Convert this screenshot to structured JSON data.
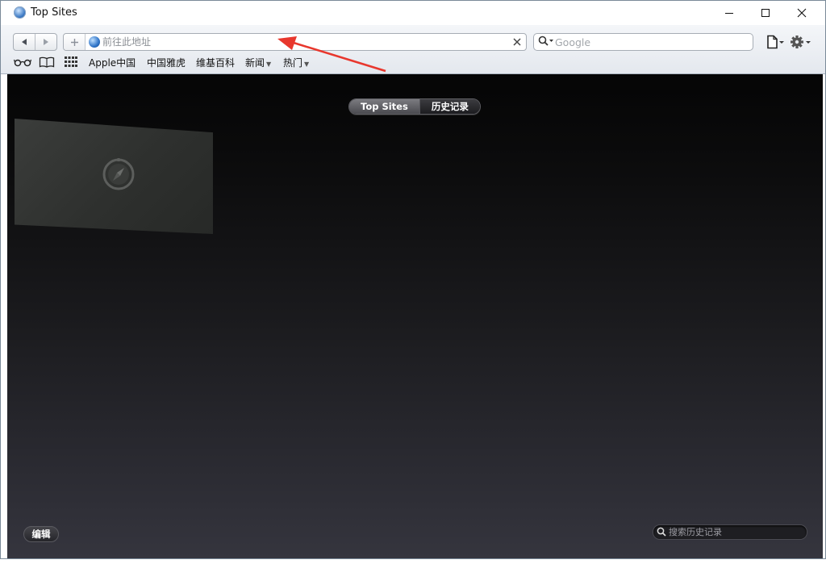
{
  "window": {
    "title": "Top Sites",
    "icon": "safari-compass-icon"
  },
  "toolbar": {
    "url_placeholder": "前往此地址",
    "search_placeholder": "Google"
  },
  "bookmarks": {
    "items": [
      {
        "label": "Apple中国"
      },
      {
        "label": "中国雅虎"
      },
      {
        "label": "维基百科"
      },
      {
        "label": "新闻",
        "menu": true
      },
      {
        "label": "热门",
        "menu": true
      }
    ]
  },
  "content": {
    "tabs": [
      {
        "label": "Top Sites",
        "active": true
      },
      {
        "label": "历史记录",
        "active": false
      }
    ],
    "edit_label": "编辑",
    "history_search_placeholder": "搜索历史记录"
  },
  "colors": {
    "annotation_arrow": "#e8372d"
  }
}
